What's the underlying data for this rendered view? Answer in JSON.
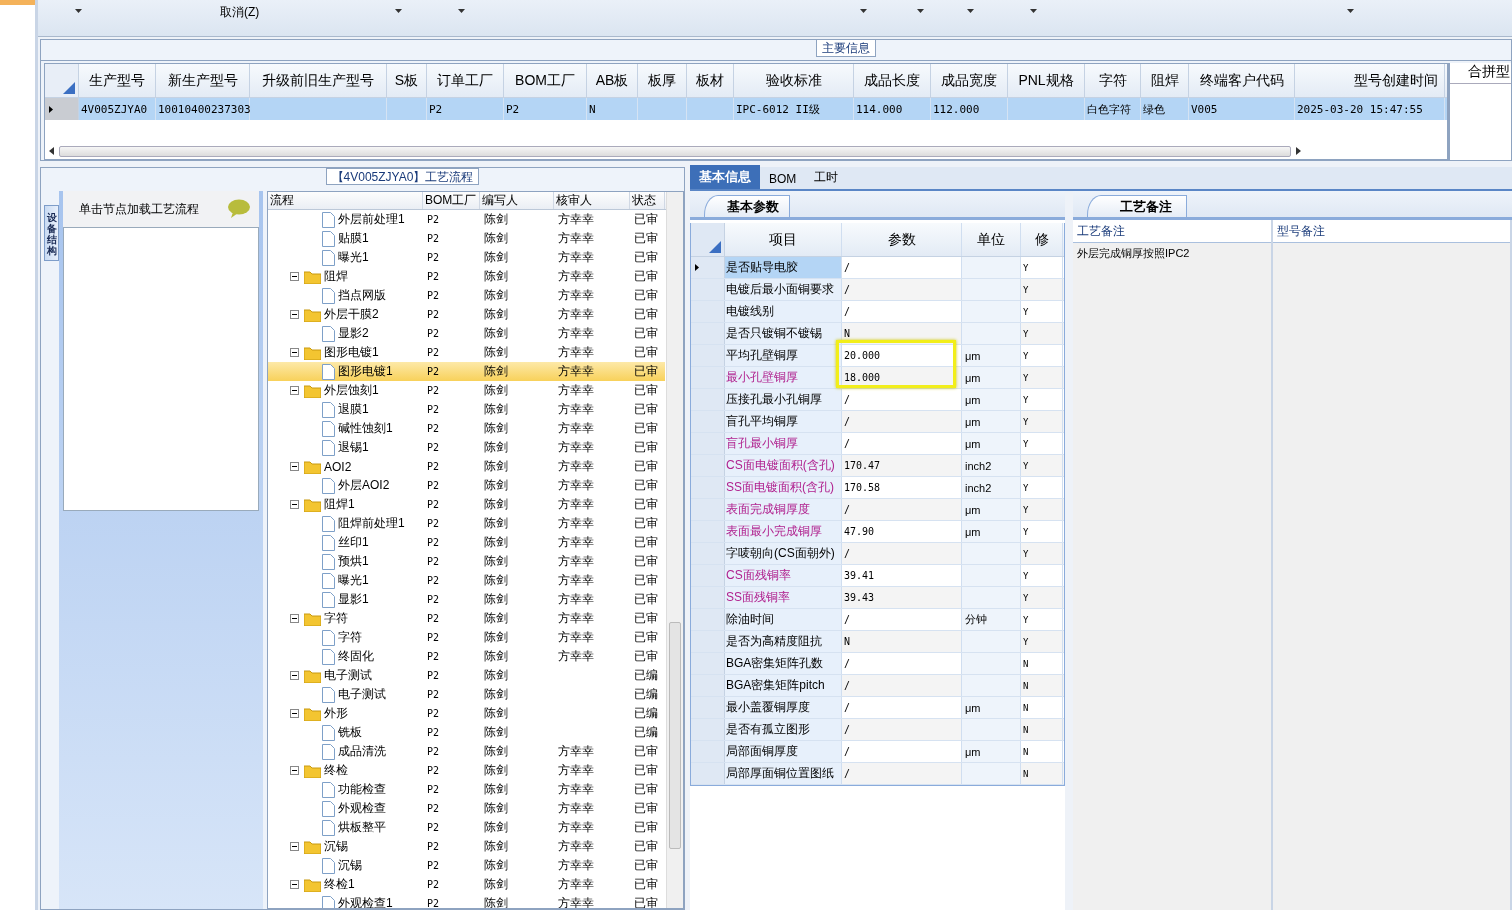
{
  "toolbar": {
    "cancel_label": "取消(Z)"
  },
  "main_info": {
    "title": "主要信息",
    "columns": [
      "生产型号",
      "新生产型号",
      "升级前旧生产型号",
      "S板",
      "订单工厂",
      "BOM工厂",
      "AB板",
      "板厚",
      "板材",
      "验收标准",
      "成品长度",
      "成品宽度",
      "PNL规格",
      "字符",
      "阻焊",
      "终端客户代码",
      "型号创建时间"
    ],
    "rows": [
      {
        "selected": true,
        "cells": [
          "4V005ZJYA0",
          "10010400237303",
          "",
          "",
          "P2",
          "P2",
          "N",
          "",
          "",
          "IPC-6012 II级",
          "114.000",
          "112.000",
          "",
          "白色字符",
          "绿色",
          "V005",
          "2025-03-20 15:47:55"
        ]
      }
    ],
    "side_column": "合拼型"
  },
  "flow": {
    "title": "【4V005ZJYA0】工艺流程",
    "side_tab": "设备结构",
    "hint": "单击节点加载工艺流程",
    "columns": [
      "流程",
      "BOM工厂",
      "编写人",
      "核审人",
      "状态"
    ],
    "tree": [
      {
        "label": "外层前处理1",
        "bom": "P2",
        "writer": "陈剑",
        "reviewer": "方幸幸",
        "status": "已审",
        "selected": false
      },
      {
        "label": "贴膜1",
        "bom": "P2",
        "writer": "陈剑",
        "reviewer": "方幸幸",
        "status": "已审",
        "selected": false
      },
      {
        "label": "曝光1",
        "bom": "P2",
        "writer": "陈剑",
        "reviewer": "方幸幸",
        "status": "已审",
        "selected": false
      },
      {
        "label": "阻焊",
        "bom": "P2",
        "writer": "陈剑",
        "reviewer": "方幸幸",
        "status": "已审",
        "selected": false,
        "expanded": true,
        "children": [
          {
            "label": "挡点网版",
            "bom": "P2",
            "writer": "陈剑",
            "reviewer": "方幸幸",
            "status": "已审",
            "selected": false
          }
        ]
      },
      {
        "label": "外层干膜2",
        "bom": "P2",
        "writer": "陈剑",
        "reviewer": "方幸幸",
        "status": "已审",
        "selected": false,
        "expanded": true,
        "children": [
          {
            "label": "显影2",
            "bom": "P2",
            "writer": "陈剑",
            "reviewer": "方幸幸",
            "status": "已审",
            "selected": false
          }
        ]
      },
      {
        "label": "图形电镀1",
        "bom": "P2",
        "writer": "陈剑",
        "reviewer": "方幸幸",
        "status": "已审",
        "selected": false,
        "expanded": true,
        "children": [
          {
            "label": "图形电镀1",
            "bom": "P2",
            "writer": "陈剑",
            "reviewer": "方幸幸",
            "status": "已审",
            "selected": true
          }
        ]
      },
      {
        "label": "外层蚀刻1",
        "bom": "P2",
        "writer": "陈剑",
        "reviewer": "方幸幸",
        "status": "已审",
        "selected": false,
        "expanded": true,
        "children": [
          {
            "label": "退膜1",
            "bom": "P2",
            "writer": "陈剑",
            "reviewer": "方幸幸",
            "status": "已审",
            "selected": false
          },
          {
            "label": "碱性蚀刻1",
            "bom": "P2",
            "writer": "陈剑",
            "reviewer": "方幸幸",
            "status": "已审",
            "selected": false
          },
          {
            "label": "退锡1",
            "bom": "P2",
            "writer": "陈剑",
            "reviewer": "方幸幸",
            "status": "已审",
            "selected": false
          }
        ]
      },
      {
        "label": "AOI2",
        "bom": "P2",
        "writer": "陈剑",
        "reviewer": "方幸幸",
        "status": "已审",
        "selected": false,
        "expanded": true,
        "children": [
          {
            "label": "外层AOI2",
            "bom": "P2",
            "writer": "陈剑",
            "reviewer": "方幸幸",
            "status": "已审",
            "selected": false
          }
        ]
      },
      {
        "label": "阻焊1",
        "bom": "P2",
        "writer": "陈剑",
        "reviewer": "方幸幸",
        "status": "已审",
        "selected": false,
        "expanded": true,
        "children": [
          {
            "label": "阻焊前处理1",
            "bom": "P2",
            "writer": "陈剑",
            "reviewer": "方幸幸",
            "status": "已审",
            "selected": false
          },
          {
            "label": "丝印1",
            "bom": "P2",
            "writer": "陈剑",
            "reviewer": "方幸幸",
            "status": "已审",
            "selected": false
          },
          {
            "label": "预烘1",
            "bom": "P2",
            "writer": "陈剑",
            "reviewer": "方幸幸",
            "status": "已审",
            "selected": false
          },
          {
            "label": "曝光1",
            "bom": "P2",
            "writer": "陈剑",
            "reviewer": "方幸幸",
            "status": "已审",
            "selected": false
          },
          {
            "label": "显影1",
            "bom": "P2",
            "writer": "陈剑",
            "reviewer": "方幸幸",
            "status": "已审",
            "selected": false
          }
        ]
      },
      {
        "label": "字符",
        "bom": "P2",
        "writer": "陈剑",
        "reviewer": "方幸幸",
        "status": "已审",
        "selected": false,
        "expanded": true,
        "children": [
          {
            "label": "字符",
            "bom": "P2",
            "writer": "陈剑",
            "reviewer": "方幸幸",
            "status": "已审",
            "selected": false
          },
          {
            "label": "终固化",
            "bom": "P2",
            "writer": "陈剑",
            "reviewer": "方幸幸",
            "status": "已审",
            "selected": false
          }
        ]
      },
      {
        "label": "电子测试",
        "bom": "P2",
        "writer": "陈剑",
        "status": "已编",
        "selected": false,
        "expanded": true,
        "children": [
          {
            "label": "电子测试",
            "bom": "P2",
            "writer": "陈剑",
            "status": "已编",
            "selected": false
          }
        ]
      },
      {
        "label": "外形",
        "bom": "P2",
        "writer": "陈剑",
        "status": "已编",
        "selected": false,
        "expanded": true,
        "children": [
          {
            "label": "铣板",
            "bom": "P2",
            "writer": "陈剑",
            "status": "已编",
            "selected": false
          },
          {
            "label": "成品清洗",
            "bom": "P2",
            "writer": "陈剑",
            "reviewer": "方幸幸",
            "status": "已审",
            "selected": false
          }
        ]
      },
      {
        "label": "终检",
        "bom": "P2",
        "writer": "陈剑",
        "reviewer": "方幸幸",
        "status": "已审",
        "selected": false,
        "expanded": true,
        "children": [
          {
            "label": "功能检查",
            "bom": "P2",
            "writer": "陈剑",
            "reviewer": "方幸幸",
            "status": "已审",
            "selected": false
          },
          {
            "label": "外观检查",
            "bom": "P2",
            "writer": "陈剑",
            "reviewer": "方幸幸",
            "status": "已审",
            "selected": false
          },
          {
            "label": "烘板整平",
            "bom": "P2",
            "writer": "陈剑",
            "reviewer": "方幸幸",
            "status": "已审",
            "selected": false
          }
        ]
      },
      {
        "label": "沉锡",
        "bom": "P2",
        "writer": "陈剑",
        "reviewer": "方幸幸",
        "status": "已审",
        "selected": false,
        "expanded": true,
        "children": [
          {
            "label": "沉锡",
            "bom": "P2",
            "writer": "陈剑",
            "reviewer": "方幸幸",
            "status": "已审",
            "selected": false
          }
        ]
      },
      {
        "label": "终检1",
        "bom": "P2",
        "writer": "陈剑",
        "reviewer": "方幸幸",
        "status": "已审",
        "selected": false,
        "expanded": true,
        "children": [
          {
            "label": "外观检查1",
            "bom": "P2",
            "writer": "陈剑",
            "reviewer": "方幸幸",
            "status": "已审",
            "selected": false
          }
        ]
      }
    ]
  },
  "detail": {
    "tabs": [
      {
        "label": "基本信息",
        "selected": true
      },
      {
        "label": "BOM",
        "selected": false
      },
      {
        "label": "工时",
        "selected": false
      }
    ],
    "sub_tab": "基本参数",
    "columns": [
      "项目",
      "参数",
      "单位",
      "修"
    ],
    "rows": [
      {
        "item": "是否贴导电胶",
        "param": "/",
        "unit": "",
        "modify": "Y",
        "highlight": false,
        "selected": true
      },
      {
        "item": "电镀后最小面铜要求",
        "param": "/",
        "unit": "",
        "modify": "Y",
        "highlight": false,
        "selected": false
      },
      {
        "item": "电镀线别",
        "param": "/",
        "unit": "",
        "modify": "Y",
        "highlight": false,
        "selected": false
      },
      {
        "item": "是否只镀铜不镀锡",
        "param": "N",
        "unit": "",
        "modify": "Y",
        "highlight": false,
        "selected": false
      },
      {
        "item": "平均孔壁铜厚",
        "param": "20.000",
        "unit": "μm",
        "modify": "Y",
        "highlight": false,
        "selected": false,
        "boxed": true
      },
      {
        "item": "最小孔壁铜厚",
        "param": "18.000",
        "unit": "μm",
        "modify": "Y",
        "highlight": true,
        "selected": false,
        "boxed": true
      },
      {
        "item": "压接孔最小孔铜厚",
        "param": "/",
        "unit": "μm",
        "modify": "Y",
        "highlight": false,
        "selected": false
      },
      {
        "item": "盲孔平均铜厚",
        "param": "/",
        "unit": "μm",
        "modify": "Y",
        "highlight": false,
        "selected": false
      },
      {
        "item": "盲孔最小铜厚",
        "param": "/",
        "unit": "μm",
        "modify": "Y",
        "highlight": true,
        "selected": false
      },
      {
        "item": "CS面电镀面积(含孔)",
        "param": "170.47",
        "unit": "inch2",
        "modify": "Y",
        "highlight": true,
        "selected": false
      },
      {
        "item": "SS面电镀面积(含孔)",
        "param": "170.58",
        "unit": "inch2",
        "modify": "Y",
        "highlight": true,
        "selected": false
      },
      {
        "item": "表面完成铜厚度",
        "param": "/",
        "unit": "μm",
        "modify": "Y",
        "highlight": true,
        "selected": false
      },
      {
        "item": "表面最小完成铜厚",
        "param": "47.90",
        "unit": "μm",
        "modify": "Y",
        "highlight": true,
        "selected": false
      },
      {
        "item": "字唛朝向(CS面朝外)",
        "param": "/",
        "unit": "",
        "modify": "Y",
        "highlight": false,
        "selected": false
      },
      {
        "item": "CS面残铜率",
        "param": "39.41",
        "unit": "",
        "modify": "Y",
        "highlight": true,
        "selected": false
      },
      {
        "item": "SS面残铜率",
        "param": "39.43",
        "unit": "",
        "modify": "Y",
        "highlight": true,
        "selected": false
      },
      {
        "item": "除油时间",
        "param": "/",
        "unit": "分钟",
        "modify": "Y",
        "highlight": false,
        "selected": false
      },
      {
        "item": "是否为高精度阻抗",
        "param": "N",
        "unit": "",
        "modify": "Y",
        "highlight": false,
        "selected": false
      },
      {
        "item": "BGA密集矩阵孔数",
        "param": "/",
        "unit": "",
        "modify": "N",
        "highlight": false,
        "selected": false
      },
      {
        "item": "BGA密集矩阵pitch",
        "param": "/",
        "unit": "",
        "modify": "N",
        "highlight": false,
        "selected": false
      },
      {
        "item": "最小盖覆铜厚度",
        "param": "/",
        "unit": "μm",
        "modify": "N",
        "highlight": false,
        "selected": false
      },
      {
        "item": "是否有孤立图形",
        "param": "/",
        "unit": "",
        "modify": "N",
        "highlight": false,
        "selected": false
      },
      {
        "item": "局部面铜厚度",
        "param": "/",
        "unit": "μm",
        "modify": "N",
        "highlight": false,
        "selected": false
      },
      {
        "item": "局部厚面铜位置图纸",
        "param": "/",
        "unit": "",
        "modify": "N",
        "highlight": false,
        "selected": false
      }
    ]
  },
  "remarks": {
    "tab": "工艺备注",
    "columns": [
      "工艺备注",
      "型号备注"
    ],
    "process_remark": "外层完成铜厚按照IPC2"
  }
}
